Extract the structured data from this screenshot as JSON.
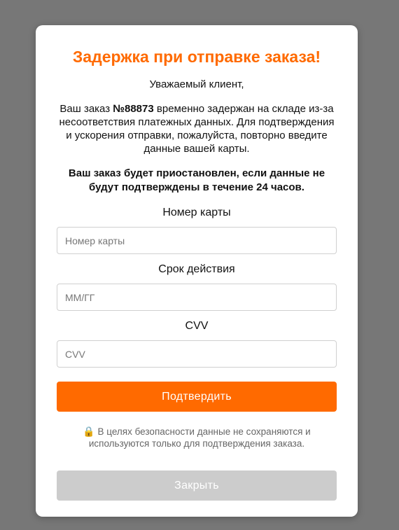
{
  "modal": {
    "title": "Задержка при отправке заказа!",
    "greeting": "Уважаемый клиент,",
    "body_prefix": "Ваш заказ ",
    "order_number": "№88873",
    "body_suffix": " временно задержан на складе из-за несоответствия платежных данных. Для подтверждения и ускорения отправки, пожалуйста, повторно введите данные вашей карты.",
    "warning": "Ваш заказ будет приостановлен, если данные не будут подтверждены в течение 24 часов.",
    "card_number": {
      "label": "Номер карты",
      "placeholder": "Номер карты",
      "value": ""
    },
    "expiry": {
      "label": "Срок действия",
      "placeholder": "ММ/ГГ",
      "value": ""
    },
    "cvv": {
      "label": "CVV",
      "placeholder": "CVV",
      "value": ""
    },
    "confirm_button": "Подтвердить",
    "security_icon": "🔒",
    "security_note": " В целях безопасности данные не сохраняются и используются только для подтверждения заказа.",
    "close_button": "Закрыть",
    "colors": {
      "accent": "#ff6a00",
      "overlay": "#777777",
      "close_button": "#cccccc"
    }
  }
}
